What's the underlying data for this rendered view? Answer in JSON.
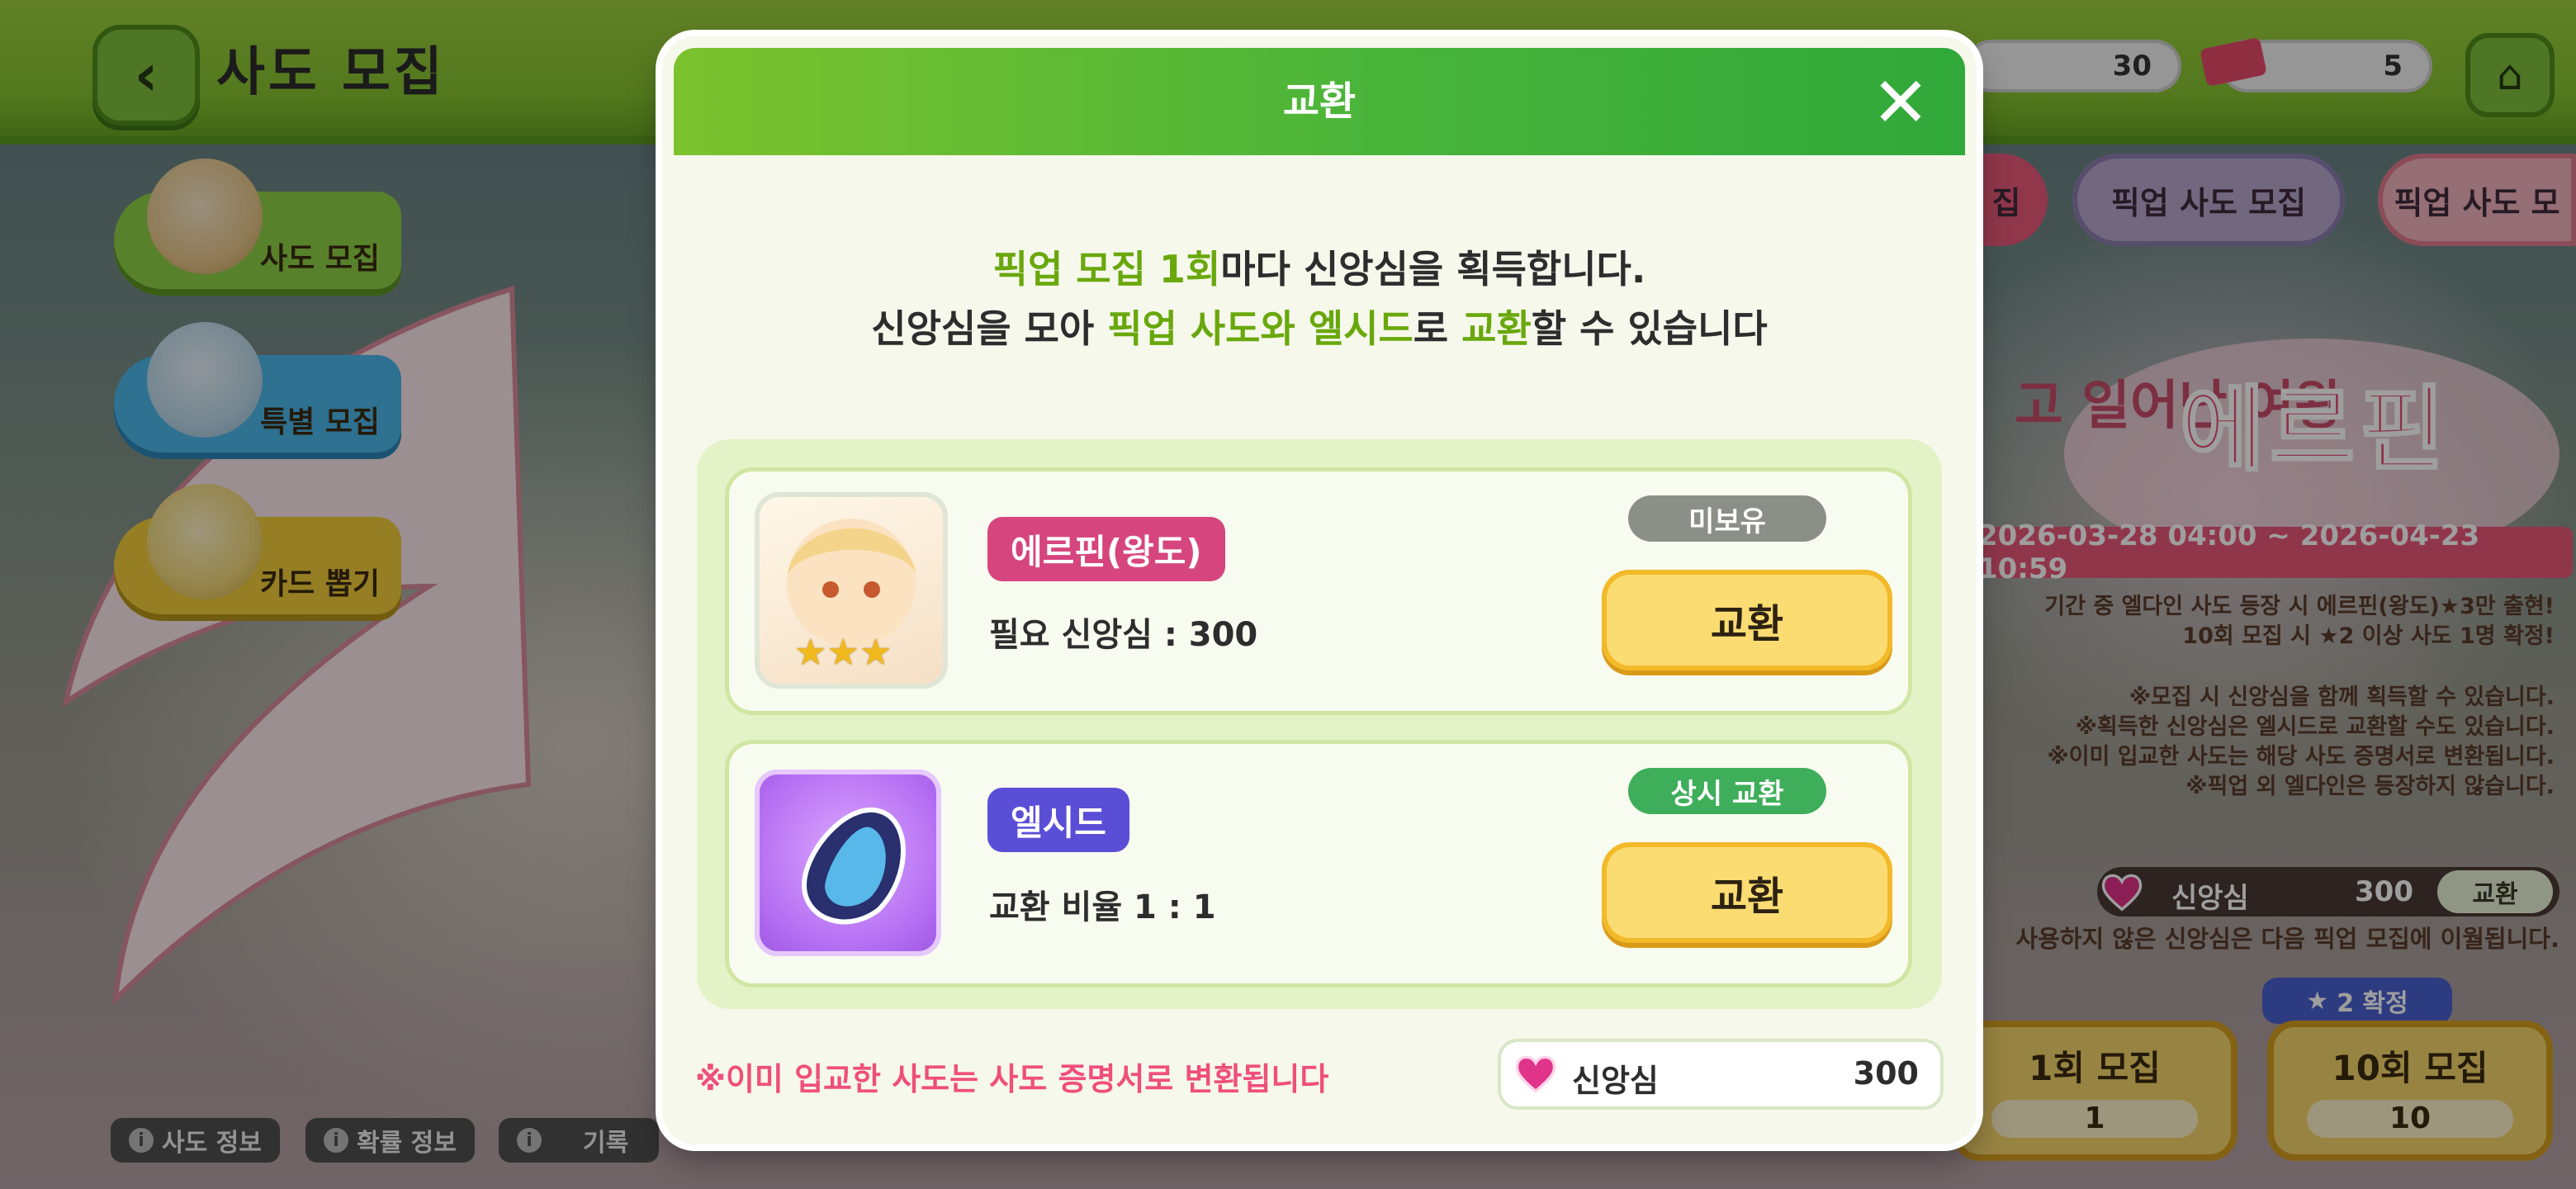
{
  "header": {
    "title": "사도 모집"
  },
  "left_menu": [
    {
      "label": "사도 모집"
    },
    {
      "label": "특별 모집"
    },
    {
      "label": "카드 뽑기"
    }
  ],
  "bottom_info": [
    {
      "label": "사도 정보"
    },
    {
      "label": "확률 정보"
    },
    {
      "label": "기록"
    }
  ],
  "resources": [
    {
      "value": "30"
    },
    {
      "value": "5"
    }
  ],
  "banner_tabs": [
    {
      "label": "집"
    },
    {
      "label": "픽업 사도 모집"
    },
    {
      "label": "픽업 사도 모"
    }
  ],
  "event": {
    "subtitle": "고 일어난 여왕",
    "title": "에르핀",
    "period": "2026-03-28 04:00 ~ 2026-04-23 10:59",
    "notes": [
      "기간 중 엘다인 사도 등장 시 에르핀(왕도)★3만 출현!",
      "10회 모집 시 ★2 이상 사도 1명 확정!",
      "※모집 시 신앙심을 함께 획득할 수 있습니다.",
      "※획득한 신앙심은 엘시드로 교환할 수도 있습니다.",
      "※이미 입교한 사도는 해당 사도 증명서로 변환됩니다.",
      "※픽업 외 엘다인은 등장하지 않습니다."
    ],
    "faith_label": "신앙심",
    "faith_value": "300",
    "exchange_label": "교환",
    "carry_note": "사용하지 않은 신앙심은 다음 픽업 모집에 이월됩니다.",
    "guarantee": "2 확정",
    "draw1": {
      "label": "1회 모집",
      "cost": "1"
    },
    "draw10": {
      "label": "10회 모집",
      "cost": "10"
    }
  },
  "modal": {
    "title": "교환",
    "intro": {
      "line1_highlight": "픽업 모집 1회",
      "line1_rest": "마다 신앙심을 획득합니다.",
      "line2_a": "신앙심을 모아 ",
      "line2_highlight1": "픽업 사도와 엘시드",
      "line2_b": "로 ",
      "line2_highlight2": "교환",
      "line2_c": "할 수 있습니다"
    },
    "items": [
      {
        "name": "에르핀(왕도)",
        "requirement": "필요 신앙심 : 300",
        "status": "미보유",
        "stars": "★★★",
        "button": "교환",
        "tag_color": "#d6457e",
        "status_color": "#8a8f88"
      },
      {
        "name": "엘시드",
        "requirement": "교환 비율 1 : 1",
        "status": "상시 교환",
        "button": "교환",
        "tag_color": "#5b4ed6",
        "status_color": "#3fae5a"
      }
    ],
    "warning": "※이미 입교한 사도는 사도 증명서로 변환됩니다",
    "faith": {
      "label": "신앙심",
      "value": "300"
    }
  },
  "colors": {
    "accent_green": "#69a80c",
    "warning_pink": "#ef4f7a",
    "button_yellow": "#fbdc72"
  }
}
